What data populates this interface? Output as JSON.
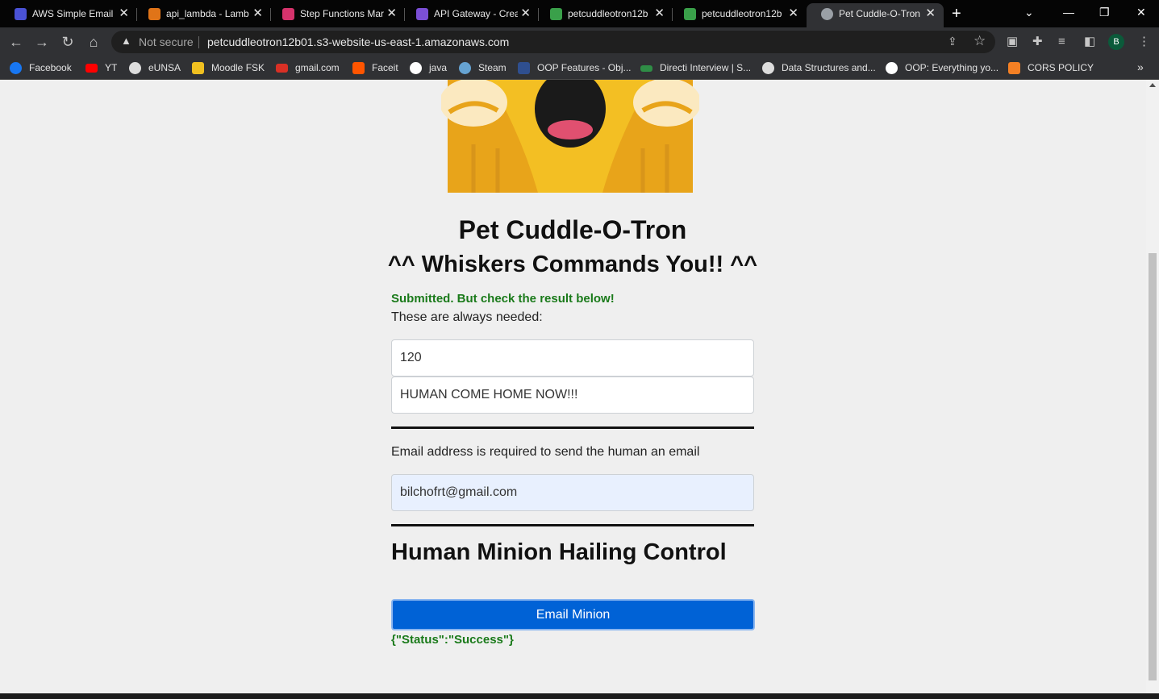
{
  "browser": {
    "tabs": [
      {
        "title": "AWS Simple Email S",
        "icon": "aws-ses-icon",
        "color": "#4a52d6"
      },
      {
        "title": "api_lambda - Lamb",
        "icon": "aws-lambda-icon",
        "color": "#e07418"
      },
      {
        "title": "Step Functions Mar",
        "icon": "step-functions-icon",
        "color": "#d6336c"
      },
      {
        "title": "API Gateway - Crea",
        "icon": "api-gateway-icon",
        "color": "#7b4fd6"
      },
      {
        "title": "petcuddleotron12b",
        "icon": "s3-bucket-icon",
        "color": "#3aa04a"
      },
      {
        "title": "petcuddleotron12b",
        "icon": "s3-bucket-icon",
        "color": "#3aa04a"
      },
      {
        "title": "Pet Cuddle-O-Tron",
        "icon": "globe-icon",
        "color": "#9aa0a6"
      }
    ],
    "not_secure": "Not secure",
    "url": "petcuddleotron12b01.s3-website-us-east-1.amazonaws.com",
    "profile_initial": "B",
    "bookmarks": [
      {
        "label": "Facebook",
        "icon": "facebook-icon",
        "color": "#1877f2"
      },
      {
        "label": "YT",
        "icon": "youtube-icon",
        "color": "#ff0000"
      },
      {
        "label": "eUNSA",
        "icon": "globe-icon",
        "color": "#dddddd"
      },
      {
        "label": "Moodle FSK",
        "icon": "moodle-icon",
        "color": "#f0c020"
      },
      {
        "label": "gmail.com",
        "icon": "gmail-icon",
        "color": "#d93025"
      },
      {
        "label": "Faceit",
        "icon": "faceit-icon",
        "color": "#ff5500"
      },
      {
        "label": "java",
        "icon": "medium-icon",
        "color": "#ffffff"
      },
      {
        "label": "Steam",
        "icon": "steam-icon",
        "color": "#66a3d2"
      },
      {
        "label": "OOP Features - Obj...",
        "icon": "stackoverflow-icon",
        "color": "#2f4f8f"
      },
      {
        "label": "Directi Interview | S...",
        "icon": "geeksforgeeks-icon",
        "color": "#2f8d46"
      },
      {
        "label": "Data Structures and...",
        "icon": "globe-icon",
        "color": "#dddddd"
      },
      {
        "label": "OOP: Everything yo...",
        "icon": "medium-icon",
        "color": "#ffffff"
      },
      {
        "label": "CORS POLICY",
        "icon": "stackoverflow-icon",
        "color": "#f48024"
      }
    ]
  },
  "page": {
    "title": "Pet Cuddle-O-Tron",
    "subtitle": "^^ Whiskers Commands You!! ^^",
    "submit_message": "Submitted. But check the result below!",
    "always_needed_label": "These are always needed:",
    "wait_value": "120",
    "message_value": "HUMAN COME HOME NOW!!!",
    "email_label": "Email address is required to send the human an email",
    "email_value": "bilchofrt@gmail.com",
    "control_heading": "Human Minion Hailing Control",
    "email_button": "Email Minion",
    "result_text": "{\"Status\":\"Success\"}"
  }
}
